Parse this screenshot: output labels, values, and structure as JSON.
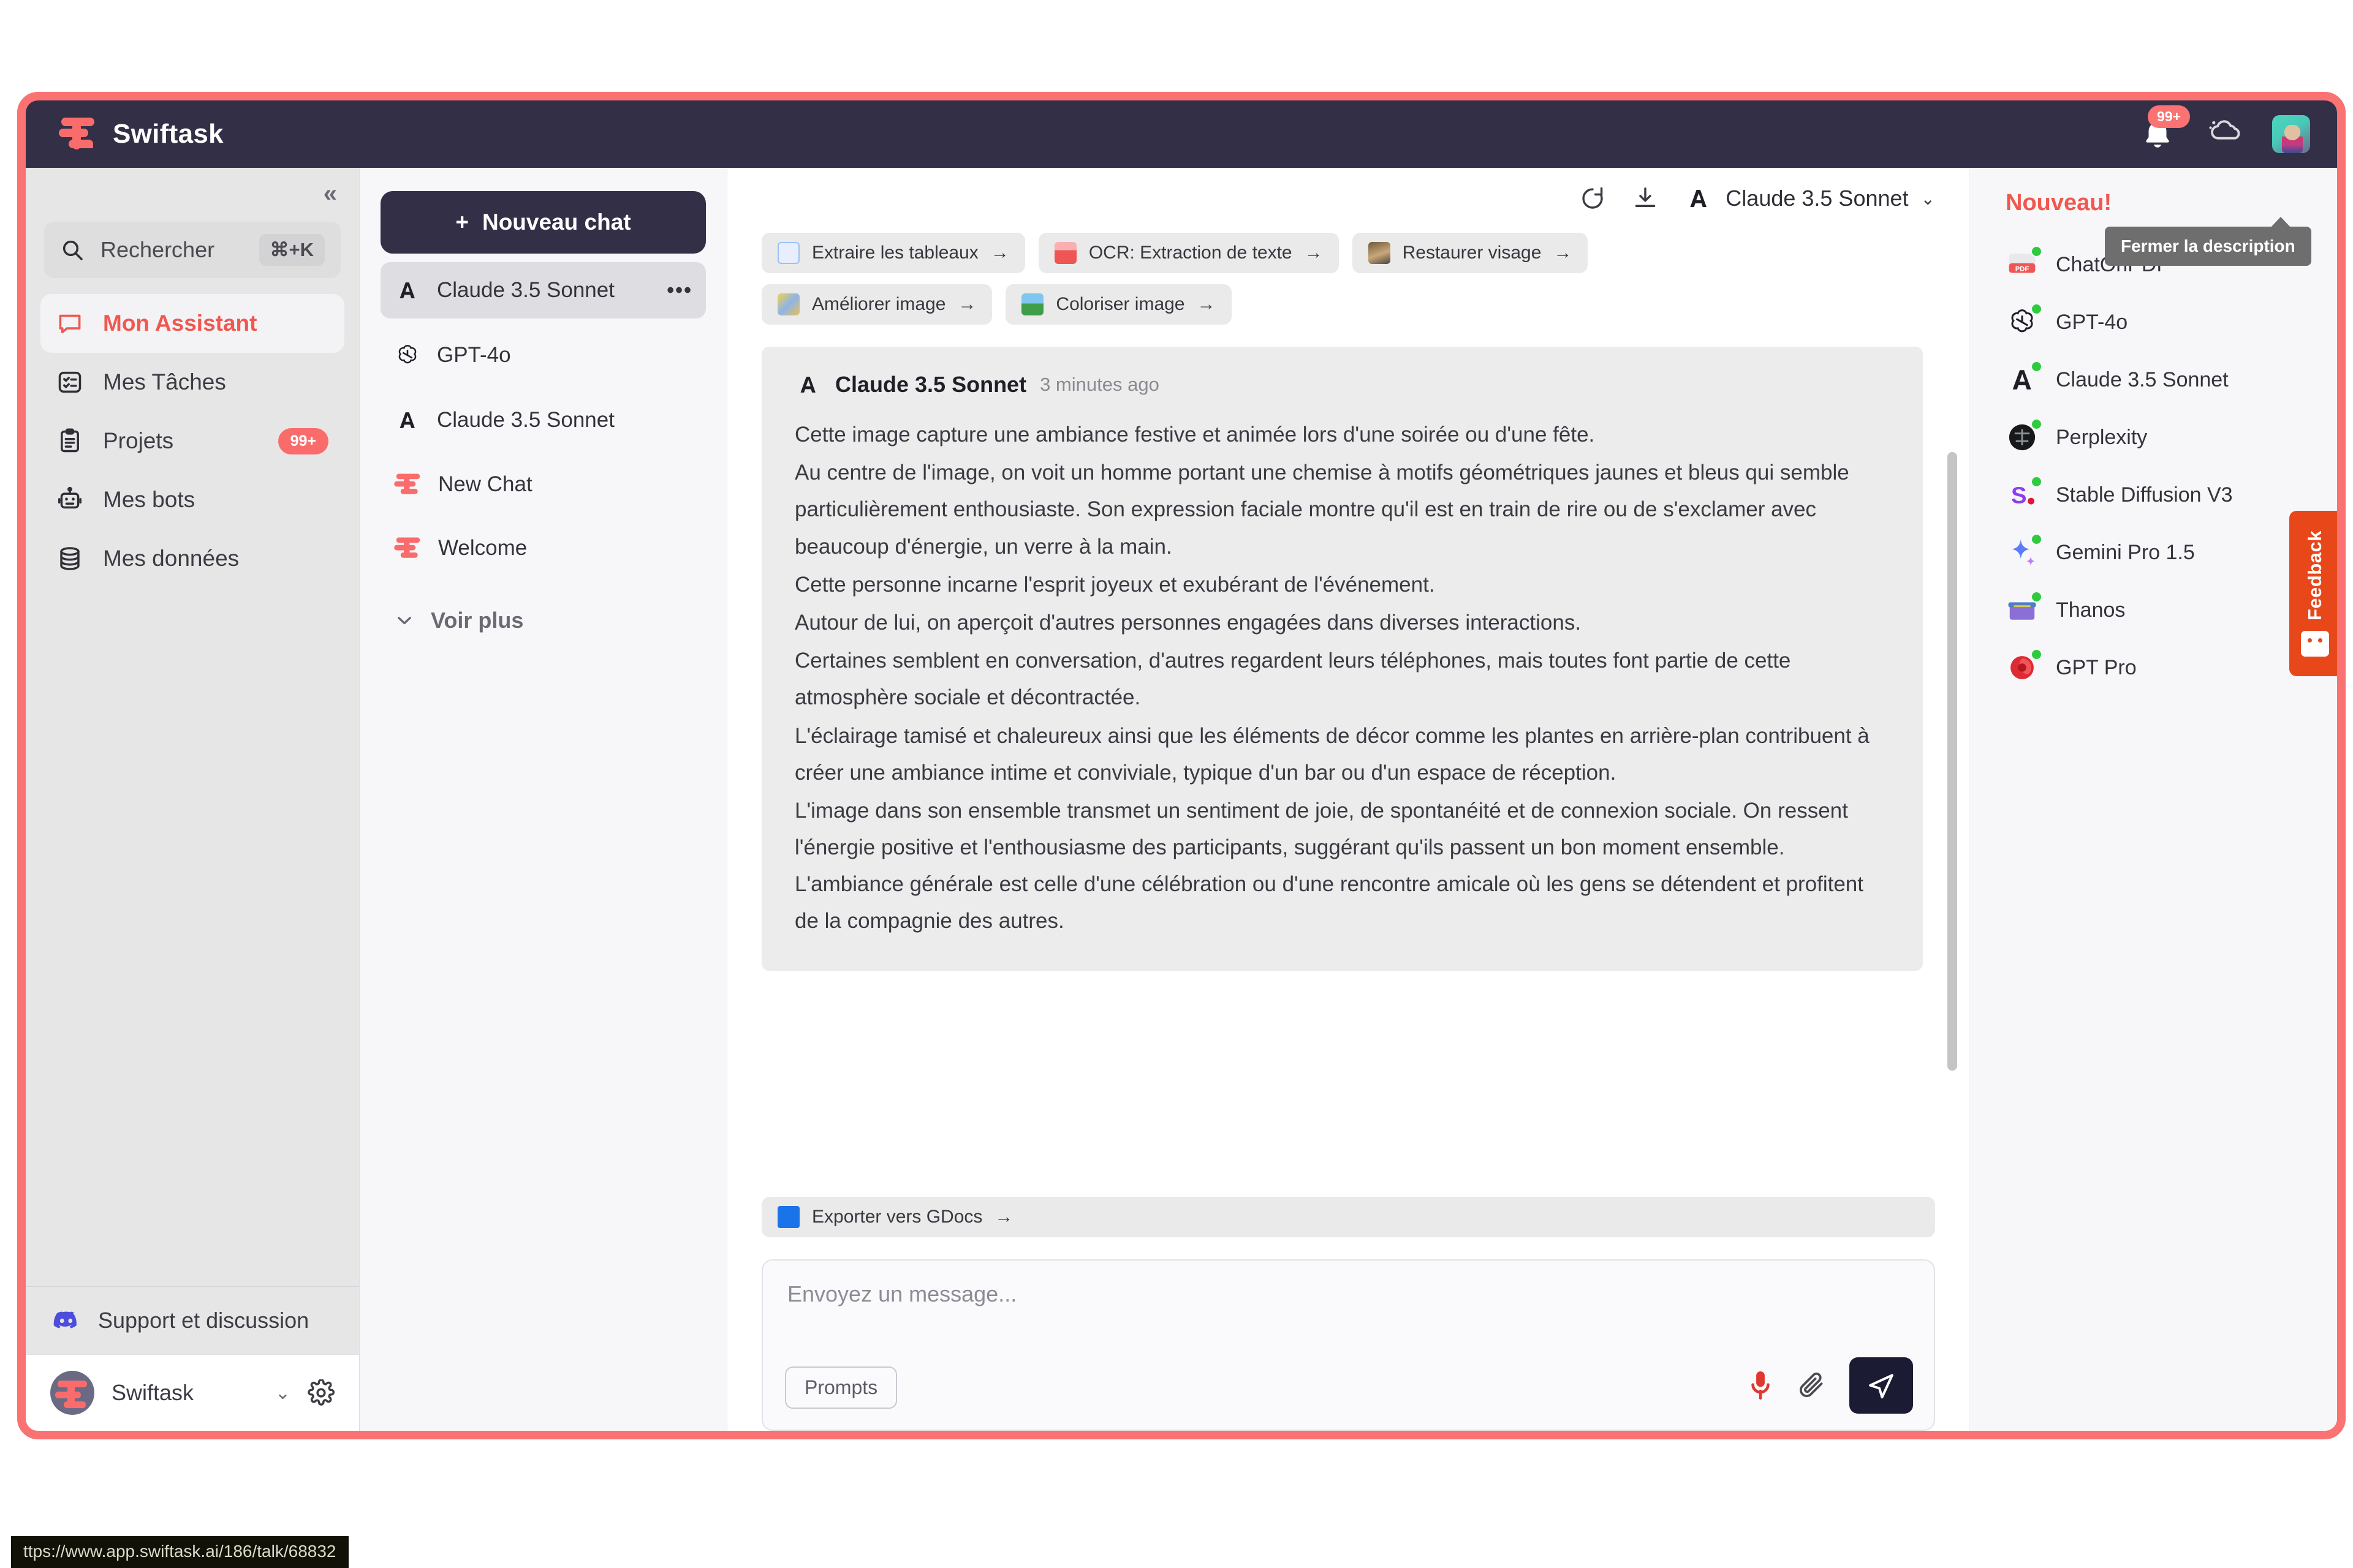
{
  "topbar": {
    "brand": "Swiftask",
    "notification_badge": "99+",
    "icons": {
      "bell": "bell-icon",
      "cloud": "cloud-icon",
      "avatar": "user-avatar"
    }
  },
  "leftnav": {
    "collapse": "«",
    "search": {
      "label": "Rechercher",
      "shortcut": "⌘+K"
    },
    "items": [
      {
        "label": "Mon Assistant",
        "icon": "chat-bubble-icon",
        "active": true,
        "badge": ""
      },
      {
        "label": "Mes Tâches",
        "icon": "tasks-icon",
        "active": false,
        "badge": ""
      },
      {
        "label": "Projets",
        "icon": "clipboard-icon",
        "active": false,
        "badge": "99+"
      },
      {
        "label": "Mes bots",
        "icon": "robot-icon",
        "active": false,
        "badge": ""
      },
      {
        "label": "Mes données",
        "icon": "database-icon",
        "active": false,
        "badge": ""
      }
    ],
    "support": {
      "label": "Support et discussion",
      "icon": "discord-icon"
    },
    "user": {
      "name": "Swiftask",
      "chevron": "⌄",
      "gear": "gear-icon"
    }
  },
  "chatlist": {
    "new_chat": "Nouveau chat",
    "new_chat_plus": "+",
    "items": [
      {
        "label": "Claude 3.5 Sonnet",
        "icon": "anthropic-icon",
        "selected": true,
        "menu": "•••"
      },
      {
        "label": "GPT-4o",
        "icon": "openai-icon",
        "selected": false,
        "menu": ""
      },
      {
        "label": "Claude 3.5 Sonnet",
        "icon": "anthropic-icon",
        "selected": false,
        "menu": ""
      },
      {
        "label": "New Chat",
        "icon": "swiftask-icon",
        "selected": false,
        "menu": ""
      },
      {
        "label": "Welcome",
        "icon": "swiftask-icon",
        "selected": false,
        "menu": ""
      }
    ],
    "see_more": "Voir plus"
  },
  "main": {
    "toolbar": {
      "refresh": "refresh-icon",
      "download": "download-icon",
      "model": "Claude 3.5 Sonnet",
      "chevron": "⌄"
    },
    "chips": [
      {
        "label": "Extraire les tableaux",
        "icon": "table-extract-icon",
        "arrow": "→"
      },
      {
        "label": "OCR: Extraction de texte",
        "icon": "ocr-icon",
        "arrow": "→"
      },
      {
        "label": "Restaurer visage",
        "icon": "face-restore-icon",
        "arrow": "→"
      },
      {
        "label": "Améliorer image",
        "icon": "enhance-image-icon",
        "arrow": "→"
      },
      {
        "label": "Coloriser image",
        "icon": "colorize-icon",
        "arrow": "→"
      }
    ],
    "message": {
      "author": "Claude 3.5 Sonnet",
      "icon": "anthropic-icon",
      "time": "3 minutes ago",
      "paragraphs": [
        "Cette image capture une ambiance festive et animée lors d'une soirée ou d'une fête.",
        "Au centre de l'image, on voit un homme portant une chemise à motifs géométriques jaunes et bleus qui semble particulièrement enthousiaste. Son expression faciale montre qu'il est en train de rire ou de s'exclamer avec beaucoup d'énergie, un verre à la main.",
        "Cette personne incarne l'esprit joyeux et exubérant de l'événement.",
        "Autour de lui, on aperçoit d'autres personnes engagées dans diverses interactions.",
        "Certaines semblent en conversation, d'autres regardent leurs téléphones, mais toutes font partie de cette atmosphère sociale et décontractée.",
        "L'éclairage tamisé et chaleureux ainsi que les éléments de décor comme les plantes en arrière-plan contribuent à créer une ambiance intime et conviviale, typique d'un bar ou d'un espace de réception.",
        "L'image dans son ensemble transmet un sentiment de joie, de spontanéité et de connexion sociale. On ressent l'énergie positive et l'enthousiasme des participants, suggérant qu'ils passent un bon moment ensemble. L'ambiance générale est celle d'une célébration ou d'une rencontre amicale où les gens se détendent et profitent de la compagnie des autres."
      ]
    },
    "export_chip": {
      "label": "Exporter vers GDocs",
      "icon": "gdocs-icon",
      "arrow": "→"
    },
    "compose": {
      "placeholder": "Envoyez un message...",
      "prompts_button": "Prompts",
      "mic": "microphone-icon",
      "attach": "paperclip-icon",
      "send": "send-icon"
    }
  },
  "rightpanel": {
    "title": "Nouveau!",
    "tooltip": "Fermer la description",
    "models": [
      {
        "label": "ChatOnPDF",
        "icon": "pdf-icon"
      },
      {
        "label": "GPT-4o",
        "icon": "openai-icon"
      },
      {
        "label": "Claude 3.5 Sonnet",
        "icon": "anthropic-icon"
      },
      {
        "label": "Perplexity",
        "icon": "perplexity-icon"
      },
      {
        "label": "Stable Diffusion V3",
        "icon": "stability-icon"
      },
      {
        "label": "Gemini Pro 1.5",
        "icon": "gemini-icon"
      },
      {
        "label": "Thanos",
        "icon": "thanos-icon"
      },
      {
        "label": "GPT Pro",
        "icon": "gptpro-icon"
      }
    ],
    "feedback": "Feedback"
  },
  "statusbar": {
    "url": "ttps://www.app.swiftask.ai/186/talk/68832"
  },
  "colors": {
    "frame_red": "#fa7272",
    "topbar_navy": "#322f47",
    "accent_coral": "#f0584f",
    "feedback_orange": "#e8471a",
    "status_green": "#2ecb3e"
  }
}
